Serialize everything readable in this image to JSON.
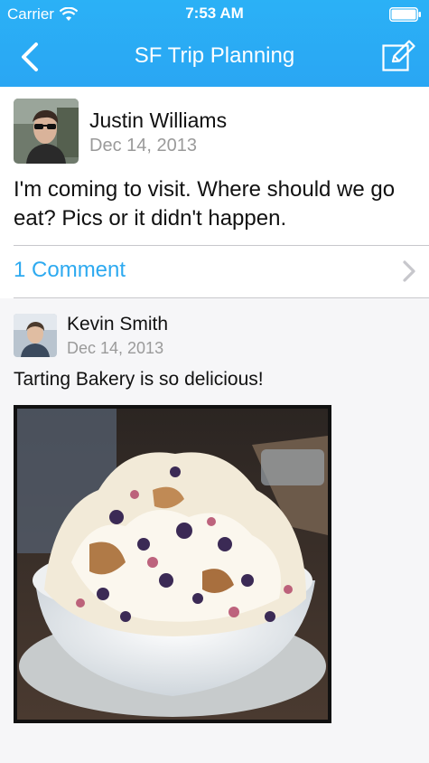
{
  "status_bar": {
    "carrier": "Carrier",
    "time": "7:53 AM",
    "wifi_icon": "wifi-icon",
    "battery_icon": "battery-icon"
  },
  "nav": {
    "title": "SF Trip Planning",
    "back_icon": "chevron-left-icon",
    "compose_icon": "compose-icon",
    "background_color": "#2aa9f4"
  },
  "post": {
    "author": "Justin Williams",
    "date": "Dec 14, 2013",
    "body": "I'm coming to visit. Where should we go eat? Pics or it didn't happen.",
    "comments_label": "1 Comment",
    "link_color": "#2eaaf0"
  },
  "comments": [
    {
      "author": "Kevin Smith",
      "date": "Dec 14, 2013",
      "text": "Tarting Bakery is so delicious!"
    }
  ]
}
